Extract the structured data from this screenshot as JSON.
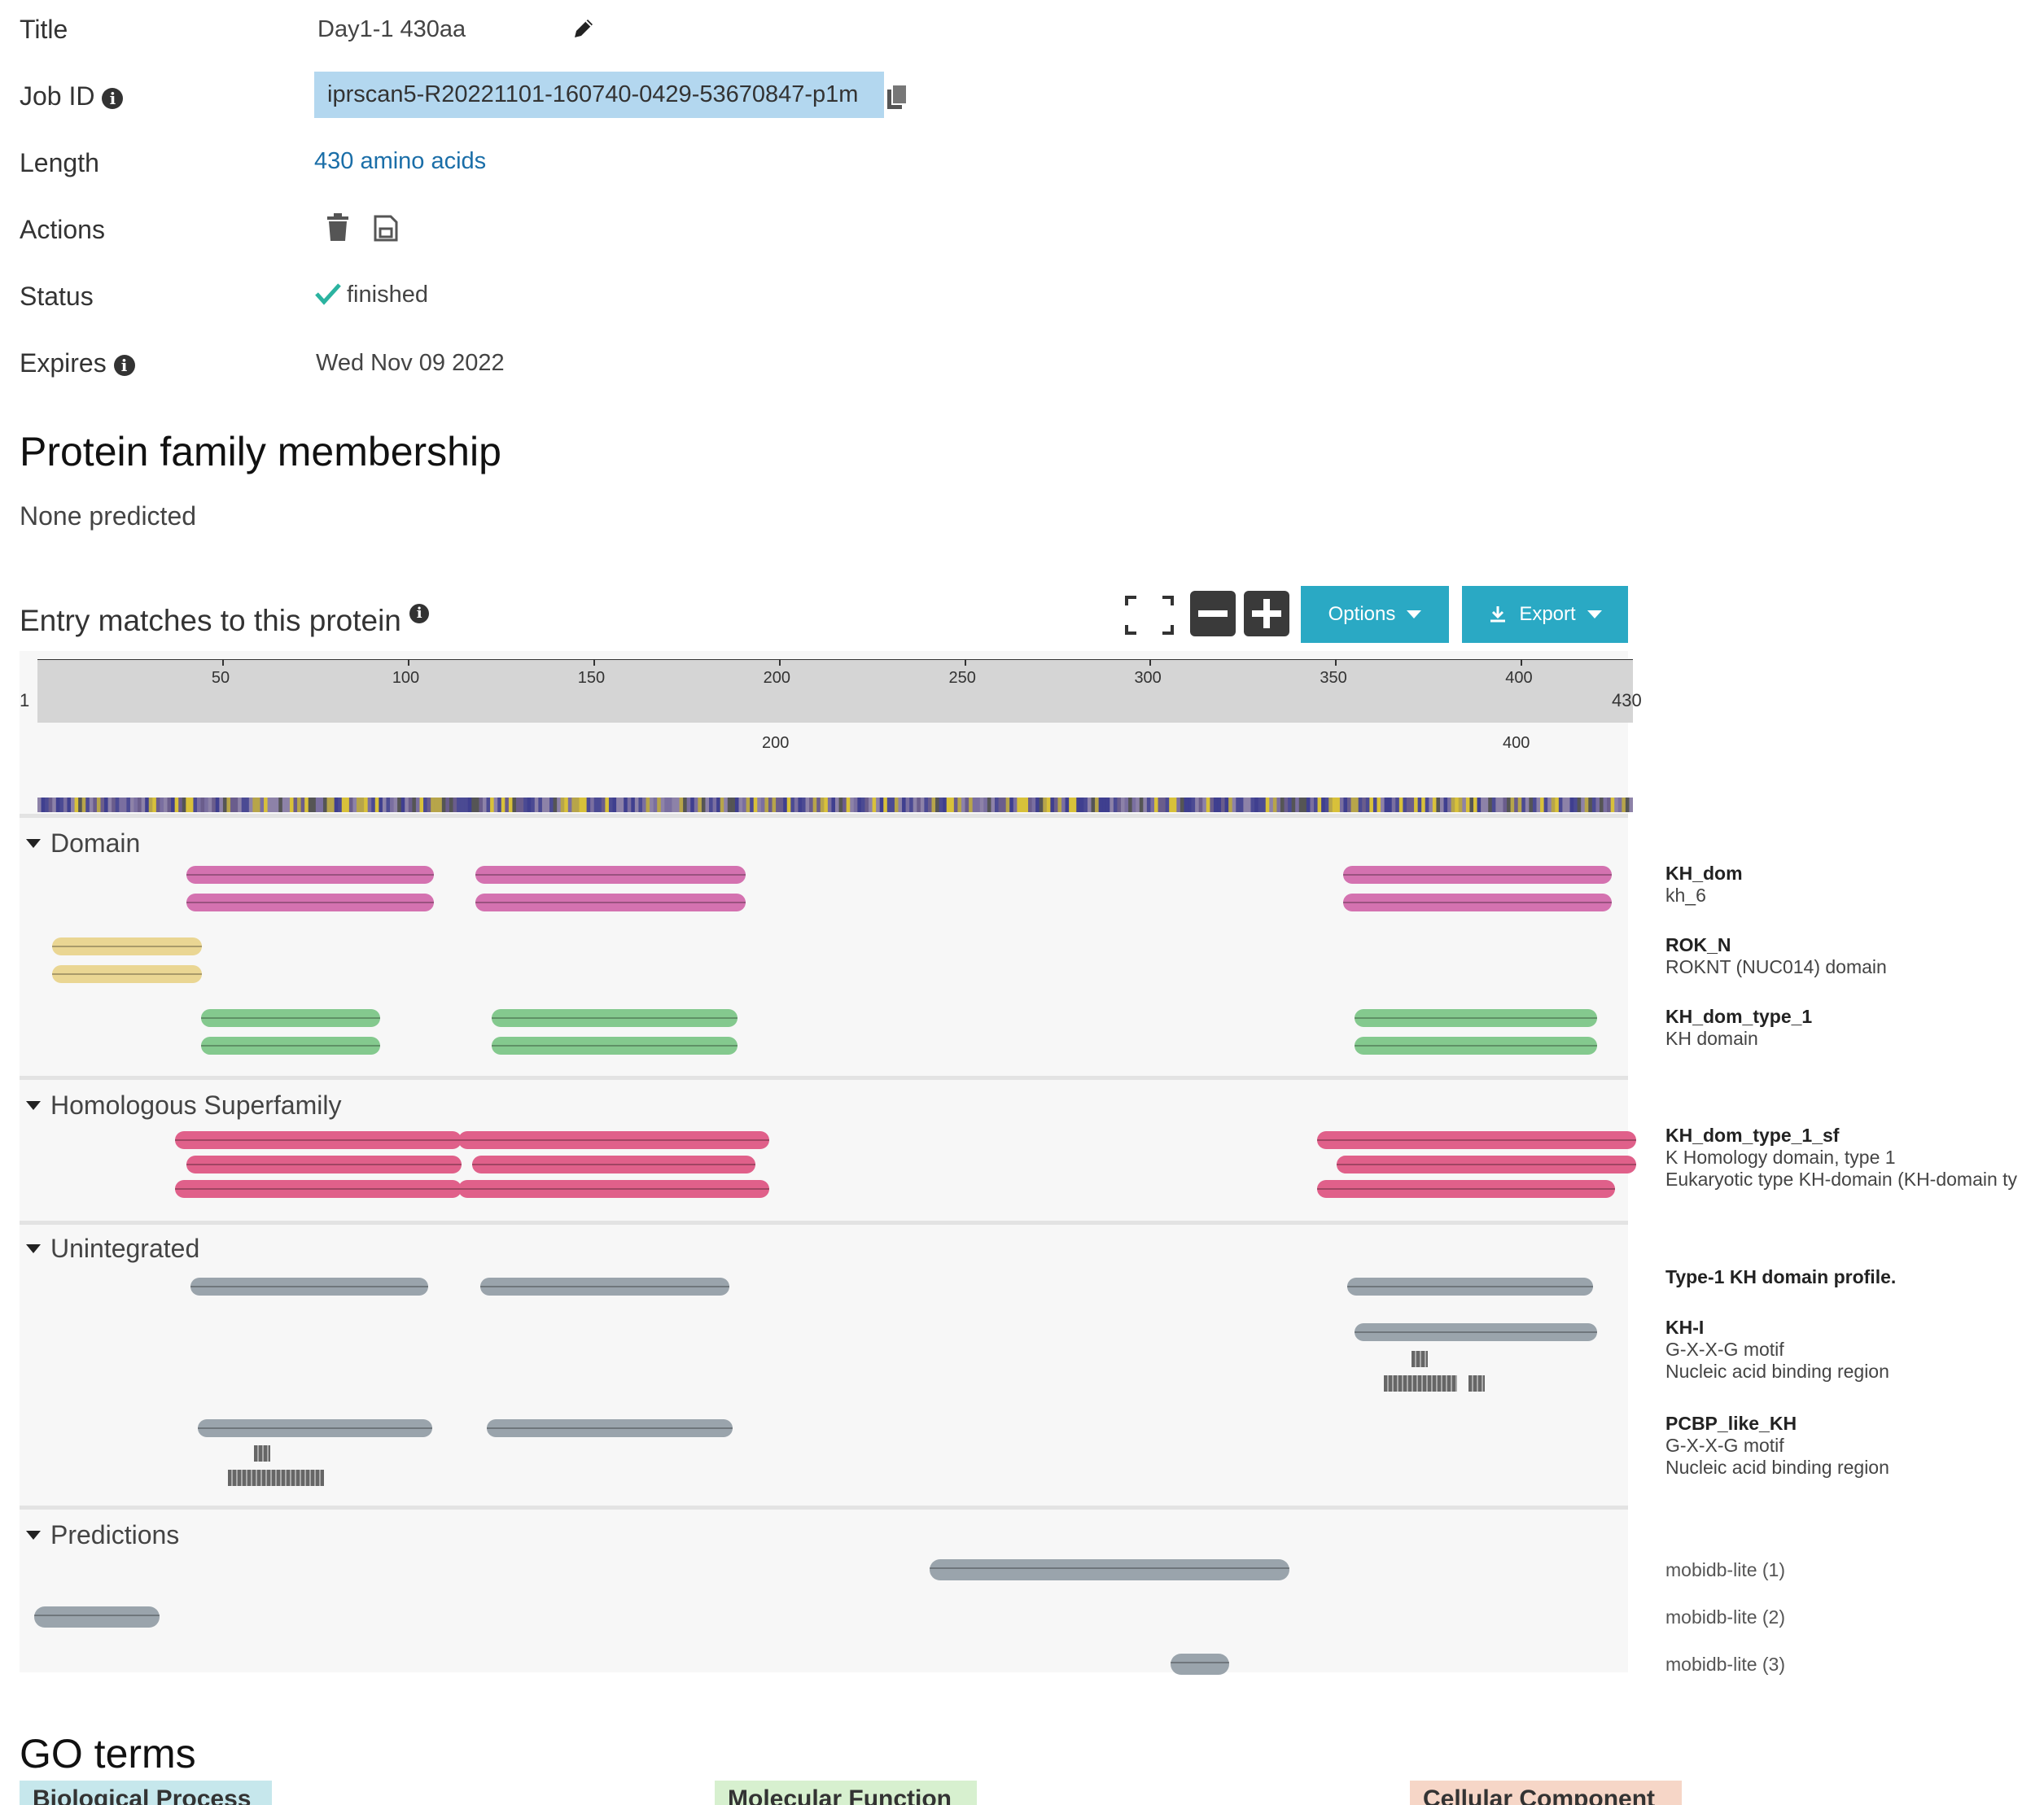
{
  "summary": {
    "title_label": "Title",
    "title_value": "Day1-1 430aa",
    "jobid_label": "Job ID",
    "jobid_value": "iprscan5-R20221101-160740-0429-53670847-p1m",
    "length_label": "Length",
    "length_value": "430 amino acids",
    "actions_label": "Actions",
    "status_label": "Status",
    "status_value": "finished",
    "expires_label": "Expires",
    "expires_value": "Wed Nov 09 2022"
  },
  "family": {
    "heading": "Protein family membership",
    "none": "None predicted"
  },
  "matches": {
    "heading": "Entry matches to this protein",
    "options_label": "Options",
    "export_label": "Export",
    "seq_start": "1",
    "seq_end": "430",
    "ruler_ticks": [
      "50",
      "100",
      "150",
      "200",
      "250",
      "300",
      "350",
      "400"
    ],
    "ruler2_ticks": [
      "200",
      "400"
    ],
    "categories": {
      "domain": "Domain",
      "homologous": "Homologous Superfamily",
      "unintegrated": "Unintegrated",
      "predictions": "Predictions"
    },
    "entries": {
      "kh_dom": {
        "title": "KH_dom",
        "sub": "kh_6"
      },
      "rok_n": {
        "title": "ROK_N",
        "sub": "ROKNT (NUC014) domain"
      },
      "kh_type1": {
        "title": "KH_dom_type_1",
        "sub": "KH domain"
      },
      "kh_type1_sf": {
        "title": "KH_dom_type_1_sf",
        "sub1": "K Homology domain, type 1",
        "sub2": "Eukaryotic type KH-domain (KH-domain ty"
      },
      "type1_profile": {
        "title": "Type-1 KH domain profile."
      },
      "kh_i": {
        "title": "KH-I",
        "sub1": "G-X-X-G motif",
        "sub2": "Nucleic acid binding region"
      },
      "pcbp": {
        "title": "PCBP_like_KH",
        "sub1": "G-X-X-G motif",
        "sub2": "Nucleic acid binding region"
      }
    },
    "mobidb": [
      "mobidb-lite (1)",
      "mobidb-lite (2)",
      "mobidb-lite (3)"
    ],
    "colors": {
      "kh_dom": "#d472b0",
      "rok_n": "#ead693",
      "kh_type1": "#84c98e",
      "kh_sf": "#e0608a",
      "unintegrated": "#9aa4ac",
      "button": "#2aa9c4"
    }
  },
  "go": {
    "heading": "GO terms",
    "bp": "Biological Process",
    "mf": "Molecular Function",
    "cc": "Cellular Component"
  }
}
